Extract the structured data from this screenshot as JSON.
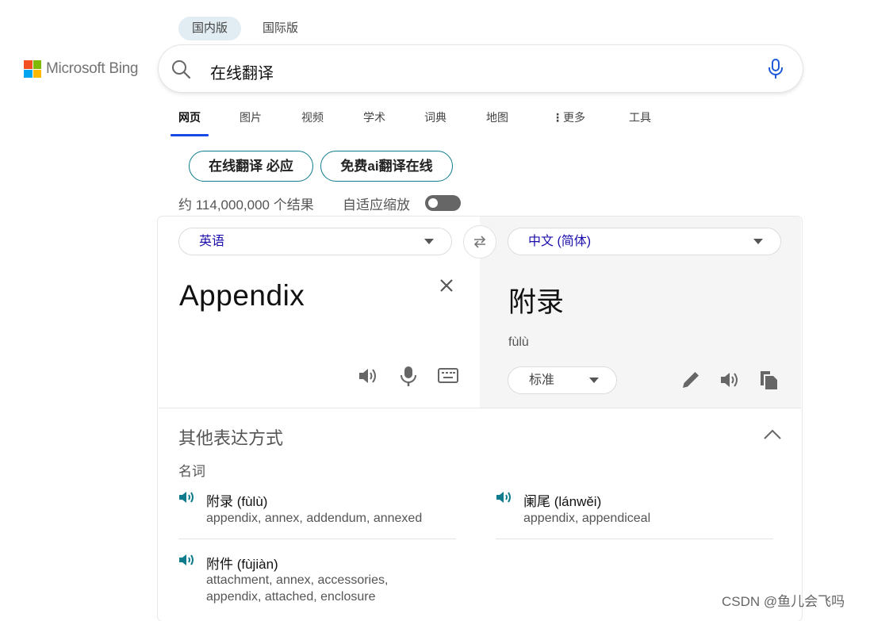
{
  "region_tabs": [
    {
      "label": "国内版"
    },
    {
      "label": "国际版"
    }
  ],
  "logo": {
    "text": "Microsoft Bing",
    "colors": [
      "#f25022",
      "#7fba00",
      "#00a4ef",
      "#ffb900"
    ]
  },
  "search": {
    "query": "在线翻译",
    "icon": "search-icon",
    "voice_icon": "microphone-icon"
  },
  "nav": [
    {
      "label": "网页"
    },
    {
      "label": "图片"
    },
    {
      "label": "视频"
    },
    {
      "label": "学术"
    },
    {
      "label": "词典"
    },
    {
      "label": "地图"
    },
    {
      "label": "更多"
    },
    {
      "label": "工具"
    }
  ],
  "suggestions": [
    "在线翻译 必应",
    "免费ai翻译在线"
  ],
  "results_count": "约 114,000,000 个结果",
  "adaptive_zoom": {
    "label": "自适应缩放",
    "on": false
  },
  "translator": {
    "source_lang": "英语",
    "target_lang": "中文 (简体)",
    "source_text": "Appendix",
    "target_text": "附录",
    "pinyin": "fùlù",
    "style": "标准",
    "accent_color": "#1a0dab"
  },
  "alternatives": {
    "heading": "其他表达方式",
    "pos": "名词",
    "items": [
      {
        "word": "附录 (fùlù)",
        "synonyms": "appendix, annex, addendum, annexed"
      },
      {
        "word": "阑尾 (lánwěi)",
        "synonyms": "appendix, appendiceal"
      },
      {
        "word": "附件 (fùjiàn)",
        "synonyms_line1": "attachment, annex, accessories,",
        "synonyms_line2": "appendix, attached, enclosure"
      }
    ]
  },
  "watermark": "CSDN @鱼儿会飞吗"
}
